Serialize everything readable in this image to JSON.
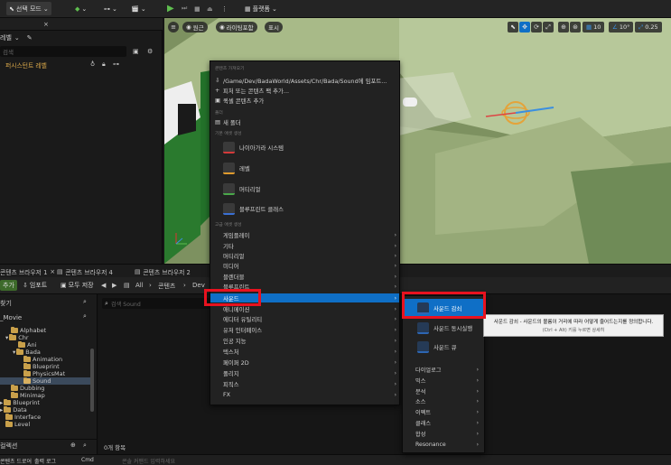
{
  "toolbar": {
    "select_mode": "선택 모드",
    "platforms": "플랫폼"
  },
  "outliner": {
    "tab_suffix": "×",
    "panel_label": "레벨",
    "search_placeholder": "검색",
    "level_item": "퍼시스턴트 레벨"
  },
  "viewport": {
    "perspective": "원근",
    "lighting": "라이팅포함",
    "show": "표시",
    "grid_snap": "10",
    "angle_snap": "10°",
    "scale_snap": "0.25"
  },
  "bottom_tabs": [
    {
      "label": "콘텐츠 브라우저 1"
    },
    {
      "label": "콘텐츠 브라우저 4"
    },
    {
      "label": "콘텐츠 브라우저 2"
    }
  ],
  "content_browser": {
    "add": "추가",
    "import": "임포트",
    "save_all": "모두 저장",
    "path": [
      "All",
      "콘텐츠",
      "Dev"
    ],
    "folder_search_label": "찾기",
    "asset_search_placeholder": "검색 Sound",
    "item_count": "0개 항목",
    "collections": "컬렉션",
    "folders": [
      {
        "label": "_Movie"
      },
      {
        "label": "Alphabet"
      },
      {
        "label": "Chr"
      },
      {
        "label": "Ani"
      },
      {
        "label": "Bada"
      },
      {
        "label": "Animation"
      },
      {
        "label": "Blueprint"
      },
      {
        "label": "PhysicsMat"
      },
      {
        "label": "Sound"
      },
      {
        "label": "Dubbing"
      },
      {
        "label": "Minimap"
      },
      {
        "label": "Blueprint"
      },
      {
        "label": "Data"
      },
      {
        "label": "Interface"
      },
      {
        "label": "Level"
      }
    ]
  },
  "context_menu": {
    "section_content": "콘텐츠 가져오기",
    "import_path": "/Game/Dev/BadaWorld/Assets/Chr/Bada/Sound에 임포트...",
    "add_feature_pack": "피처 또는 콘텐츠 팩 추가...",
    "add_quixel": "퀵셀 콘텐츠 추가",
    "section_folder": "폴더",
    "new_folder": "새 폴더",
    "section_basic": "기본 애셋 생성",
    "basic_assets": [
      {
        "label": "나이아가라 시스템",
        "accent": "#d43a3a"
      },
      {
        "label": "레벨",
        "accent": "#e09b2d"
      },
      {
        "label": "머티리얼",
        "accent": "#4aa84a"
      },
      {
        "label": "블루프린트 클래스",
        "accent": "#3a6fd4"
      }
    ],
    "section_advanced": "고급 애셋 생성",
    "categories": [
      {
        "label": "게임플레이"
      },
      {
        "label": "기타"
      },
      {
        "label": "머티리얼"
      },
      {
        "label": "미디어"
      },
      {
        "label": "블렌더블"
      },
      {
        "label": "블루프린트"
      },
      {
        "label": "사운드"
      },
      {
        "label": "애니메이션"
      },
      {
        "label": "에디터 유틸리티"
      },
      {
        "label": "유저 인터페이스"
      },
      {
        "label": "인공 지능"
      },
      {
        "label": "텍스처"
      },
      {
        "label": "페이퍼 2D"
      },
      {
        "label": "폴리지"
      },
      {
        "label": "피직스"
      },
      {
        "label": "FX"
      }
    ]
  },
  "sound_submenu": {
    "big_items": [
      {
        "label": "사운드 감쇠"
      },
      {
        "label": "사운드 동시실행"
      },
      {
        "label": "사운드 큐"
      }
    ],
    "items": [
      {
        "label": "다이얼로그"
      },
      {
        "label": "믹스"
      },
      {
        "label": "분석"
      },
      {
        "label": "소스"
      },
      {
        "label": "이펙트"
      },
      {
        "label": "클래스"
      },
      {
        "label": "합성"
      },
      {
        "label": "Resonance"
      }
    ]
  },
  "tooltip": {
    "line1": "사운드 감쇠 - 사운드의 볼륨이 거리에 따라 어떻게 줄어드는지를 정의합니다.",
    "line2": "(Ctrl + Alt) 키를 누르면 상세히"
  },
  "status_bar": {
    "content_drawer": "콘텐츠 드로어",
    "output_log": "출력 로그",
    "cmd": "Cmd",
    "console_placeholder": "콘솔 커맨드 입력하세요"
  },
  "colors": {
    "highlight": "#0f6fc6",
    "annotation_red": "#e8121f",
    "folder": "#c9a04a"
  }
}
